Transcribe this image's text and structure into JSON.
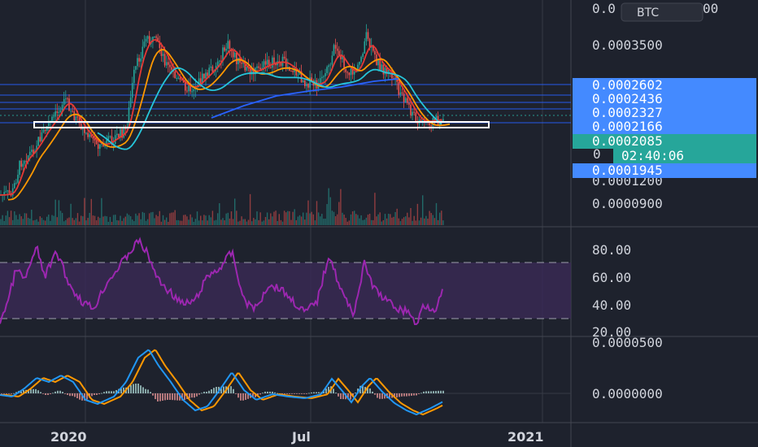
{
  "symbol": "BTC",
  "colors": {
    "background": "#1e222d",
    "grid": "#363a45",
    "axis": "#787b86",
    "candle_up": "#26a69a",
    "candle_down": "#ef5350",
    "volume_up": "#26a69a",
    "volume_down": "#ef5350",
    "ma_red": "#e53935",
    "ma_orange": "#ff9800",
    "ma_cyan": "#26c6da",
    "ma_blue": "#2962ff",
    "hline": "#2962ff",
    "price_tag_blue": "#448aff",
    "price_tag_teal": "#26a69a",
    "rsi_line": "#9c27b0",
    "rsi_band": "#3a2a55",
    "macd_line": "#2196f3",
    "signal_line": "#ff9800",
    "zone_box": "#ffffff"
  },
  "chart_data": [
    {
      "type": "candlestick",
      "panel": "price",
      "x_axis_labels": [
        "2020",
        "Jul",
        "2021"
      ],
      "y_ticks": [
        "0.0000900",
        "0.0003500",
        "0.0002085"
      ],
      "top_cut_label": "0.0",
      "top_cut_label_2": "00",
      "hidden_tick": "0.0001200",
      "price_levels": [
        "0.0002602",
        "0.0002436",
        "0.0002327",
        "0.0002166",
        "0.0001945"
      ],
      "current_price": "0.0002085",
      "countdown": "02:40:06",
      "current_tag_prefix": "0",
      "ylim": [
        8e-05,
        0.0004
      ],
      "overlays": [
        "moving averages (red, orange, cyan, blue)",
        "horizontal price lines",
        "support zone rectangle"
      ],
      "series_note": "daily candles, values approximate"
    },
    {
      "type": "line",
      "panel": "rsi",
      "y_ticks": [
        "80.00",
        "60.00",
        "40.00",
        "20.00"
      ],
      "ylim": [
        15,
        95
      ],
      "bands": [
        30,
        70
      ],
      "last_value": 48
    },
    {
      "type": "line",
      "panel": "macd",
      "y_ticks": [
        "0.0000500",
        "0.0000000"
      ],
      "series": [
        {
          "name": "",
          "color": "#2196f3"
        },
        {
          "name": "",
          "color": "#ff9800"
        }
      ]
    }
  ]
}
